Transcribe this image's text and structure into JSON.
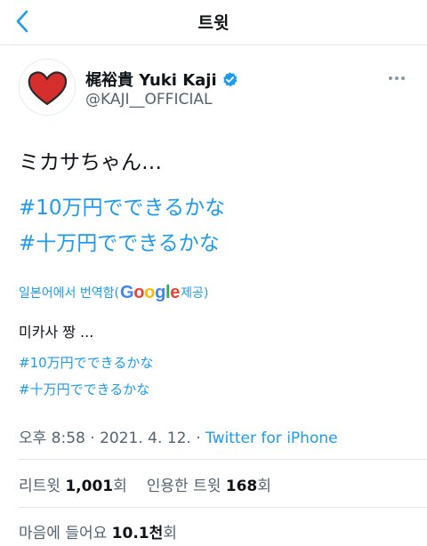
{
  "header": {
    "title": "트윗"
  },
  "author": {
    "name": "梶裕貴 Yuki Kaji",
    "handle": "@KAJI__OFFICIAL"
  },
  "tweet": {
    "text": "ミカサちゃん…",
    "hashtags": [
      "#10万円でできるかな",
      "#十万円でできるかな"
    ]
  },
  "translation": {
    "prefix": "일본어에서 번역함(",
    "google": [
      "G",
      "o",
      "o",
      "g",
      "l",
      "e"
    ],
    "suffix": " 제공)",
    "text": "미카사 짱 ...",
    "hashtags": [
      "#10万円でできるかな",
      "#十万円でできるかな"
    ]
  },
  "meta": {
    "time": "오후 8:58",
    "date": "2021. 4. 12.",
    "source": "Twitter for iPhone"
  },
  "stats": {
    "retweets_label": "리트윗",
    "retweets_value": "1,001",
    "retweets_unit": "회",
    "quotes_label": "인용한 트윗",
    "quotes_value": "168",
    "quotes_unit": "회",
    "likes_label": "마음에 들어요",
    "likes_value": "10.1천",
    "likes_unit": "회"
  },
  "colors": {
    "accent": "#1d9bf0",
    "text": "#0f1419",
    "muted": "#536471",
    "heart": "#d62d2d",
    "google": [
      "#4285F4",
      "#EA4335",
      "#FBBC05",
      "#4285F4",
      "#34A853",
      "#EA4335"
    ]
  },
  "icons": {
    "back": "chevron-left-icon",
    "verified": "verified-badge-icon",
    "more": "more-horizontal-icon",
    "avatar": "heart-avatar"
  }
}
